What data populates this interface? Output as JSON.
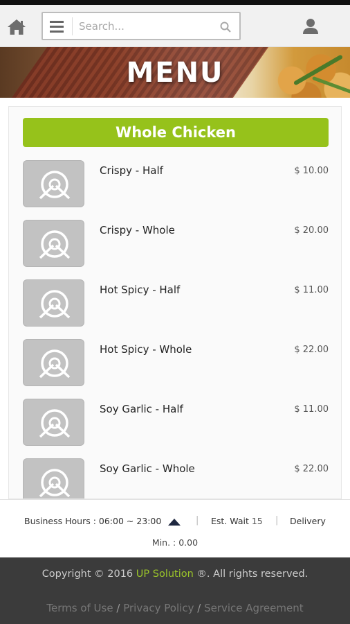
{
  "header": {
    "search_placeholder": "Search..."
  },
  "banner": {
    "title": "MENU"
  },
  "category": {
    "title": "Whole Chicken"
  },
  "items": [
    {
      "name": "Crispy - Half",
      "price": "$ 10.00"
    },
    {
      "name": "Crispy - Whole",
      "price": "$ 20.00"
    },
    {
      "name": "Hot Spicy - Half",
      "price": "$ 11.00"
    },
    {
      "name": "Hot Spicy - Whole",
      "price": "$ 22.00"
    },
    {
      "name": "Soy Garlic - Half",
      "price": "$ 11.00"
    },
    {
      "name": "Soy Garlic - Whole",
      "price": "$ 22.00"
    }
  ],
  "info": {
    "business_hours_label": "Business Hours : 06:00 ~ 23:00",
    "est_wait_label": "Est. Wait",
    "est_wait_value": "15",
    "delivery_label": "Delivery",
    "min_label": "Min. : 0.00",
    "separator": "|"
  },
  "footer": {
    "copyright_prefix": "Copyright © 2016 ",
    "brand": "UP Solution",
    "copyright_suffix": " ®. All rights reserved.",
    "links": [
      "Terms of Use",
      "Privacy Policy",
      "Service Agreement"
    ],
    "link_separator": "/"
  },
  "colors": {
    "accent_green": "#96c21b",
    "footer_bg": "#3b3b3b",
    "thumb_bg": "#c2c2c2"
  },
  "icons": {
    "home": "home-icon",
    "menu": "hamburger-menu-icon",
    "search": "search-icon",
    "user": "user-icon",
    "placeholder": "dish-placeholder-icon",
    "scroll_top": "arrow-up-icon"
  }
}
